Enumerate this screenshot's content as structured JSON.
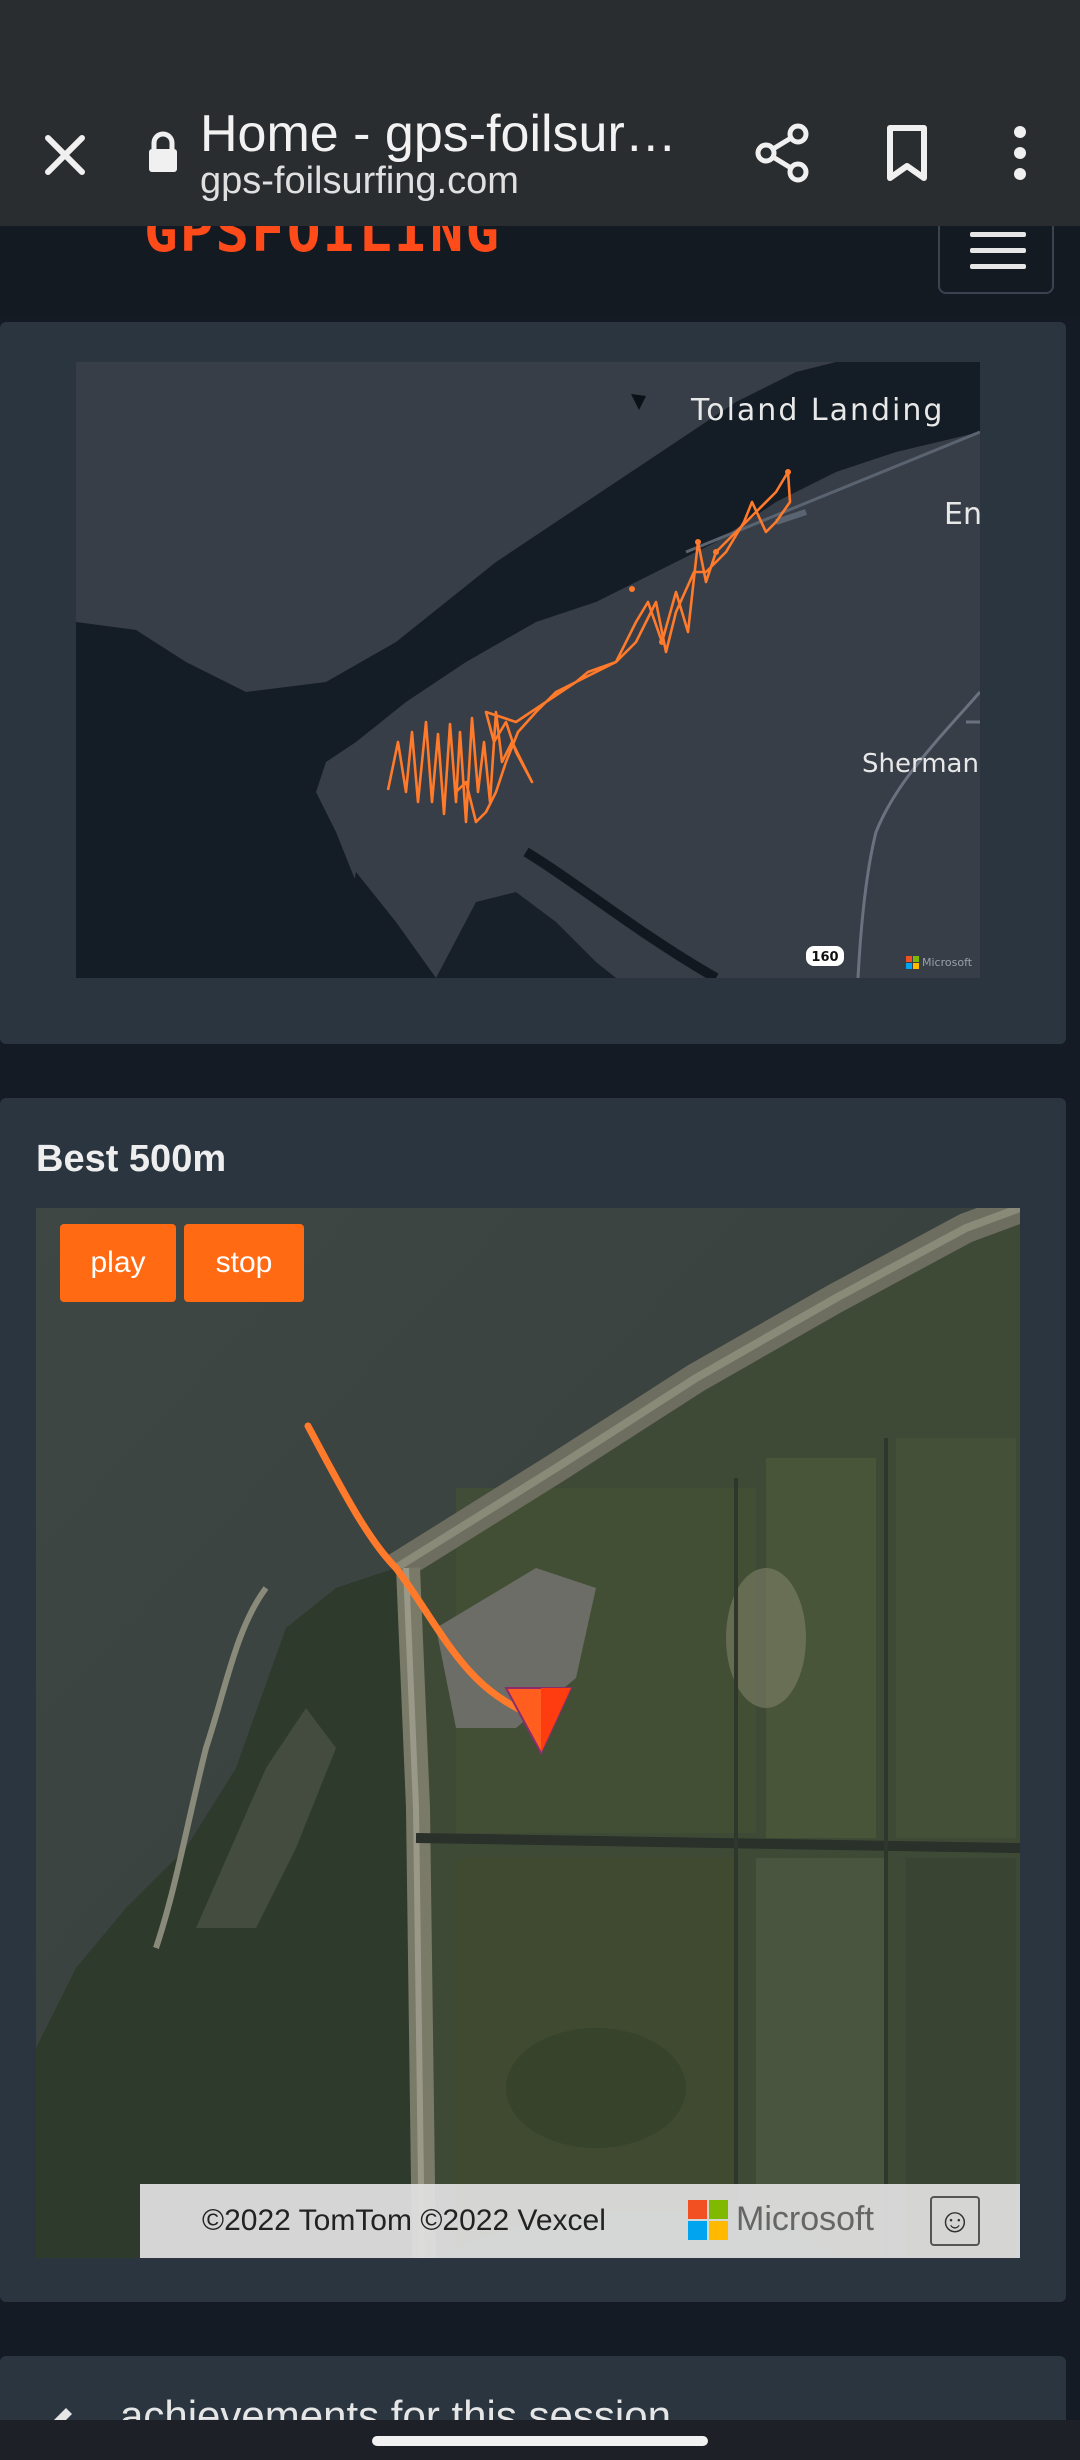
{
  "browser": {
    "title": "Home - gps-foilsur…",
    "url": "gps-foilsurfing.com"
  },
  "site": {
    "logo_text": "GPSFOILING"
  },
  "overview_map": {
    "labels": {
      "toland": "Toland Landing",
      "en": "En",
      "sherman": "Sherman",
      "route": "160",
      "brand": "Microsoft"
    }
  },
  "best_section": {
    "title": "Best 500m",
    "play_label": "play",
    "stop_label": "stop",
    "attribution": "©2022 TomTom  ©2022 Vexcel",
    "brand": "Microsoft",
    "feedback_icon": "smiley-icon"
  },
  "achievements": {
    "title": "achievements for this session"
  },
  "colors": {
    "accent": "#ff6a13",
    "track": "#ff7a2a",
    "card": "#2a3540",
    "page": "#151b24"
  }
}
